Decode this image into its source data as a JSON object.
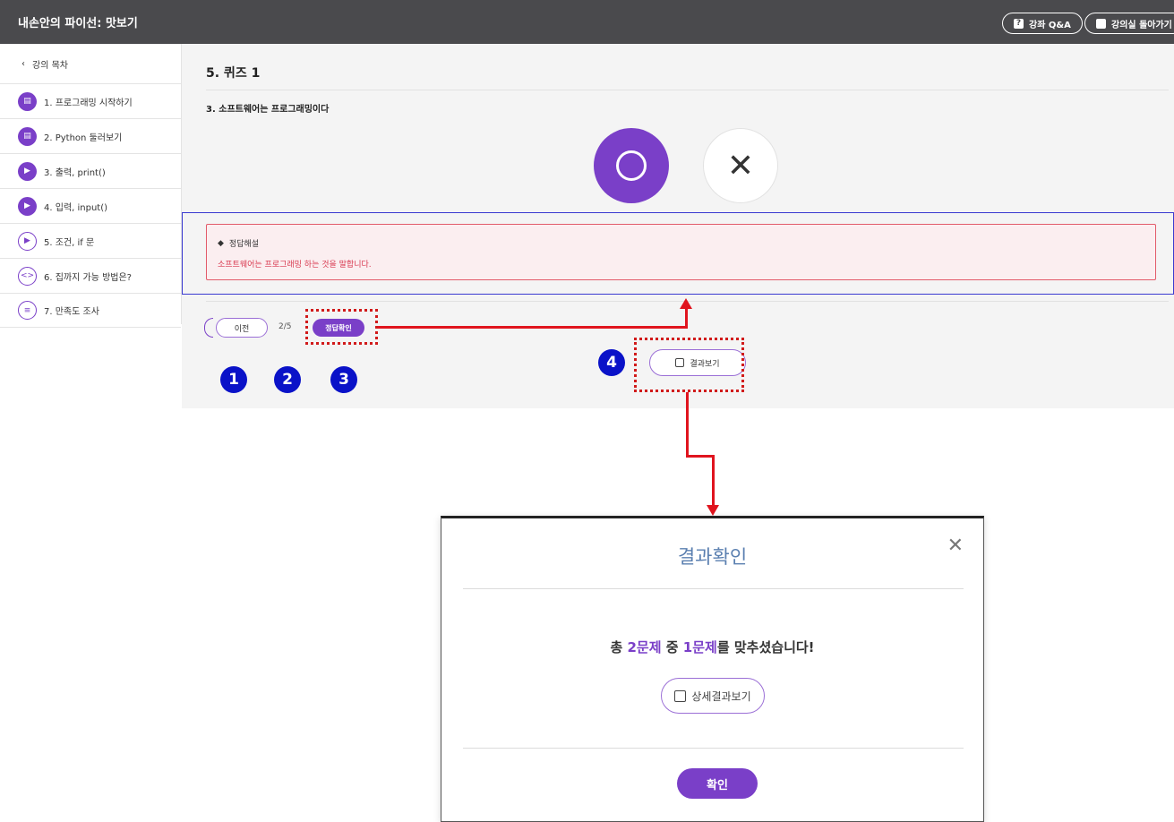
{
  "header": {
    "title": "내손안의 파이선: 맛보기",
    "qa_label": "강좌 Q&A",
    "back_label": "강의실 돌아가기"
  },
  "sidebar": {
    "back_label": "강의 목차",
    "items": [
      {
        "label": "1. 프로그래밍 시작하기",
        "icon": "document-icon"
      },
      {
        "label": "2. Python 둘러보기",
        "icon": "document-icon"
      },
      {
        "label": "3. 출력, print()",
        "icon": "video-icon"
      },
      {
        "label": "4. 입력, input()",
        "icon": "video-icon"
      },
      {
        "label": "5. 조건, if 문",
        "icon": "video-icon"
      },
      {
        "label": "6. 집까지 가능 방법은?",
        "icon": "code-icon"
      },
      {
        "label": "7. 만족도 조사",
        "icon": "survey-icon"
      }
    ]
  },
  "quiz": {
    "title": "5. 퀴즈 1",
    "question": "3. 소프트웨어는 프로그래밍이다",
    "choice_x": "✕",
    "explain_title": "정답해설",
    "explain_text": "소프트웨어는 프로그래밍 하는 것을 말합니다.",
    "prev_label": "이전",
    "page_indicator": "2/5",
    "check_label": "정답확인",
    "result_label": "결과보기"
  },
  "badges": [
    "1",
    "2",
    "3",
    "4"
  ],
  "modal": {
    "title": "결과확인",
    "msg_prefix": "총 ",
    "msg_total": "2문제",
    "msg_mid": " 중 ",
    "msg_correct": "1문제",
    "msg_suffix": "를 맞추셨습니다!",
    "detail_label": "상세결과보기",
    "ok_label": "확인"
  },
  "colors": {
    "accent": "#7a3fc8",
    "topbar": "#4a4a4d",
    "error": "#d8384f",
    "badge": "#0a12c8",
    "arrow": "#e0141e"
  }
}
